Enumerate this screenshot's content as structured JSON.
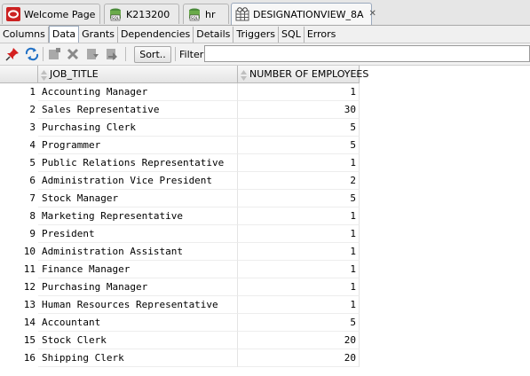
{
  "doc_tabs": [
    {
      "label": "Welcome Page",
      "icon": "oracle-icon"
    },
    {
      "label": "K213200",
      "icon": "sql-worksheet-icon"
    },
    {
      "label": "hr",
      "icon": "sql-worksheet-icon"
    },
    {
      "label": "DESIGNATIONVIEW_8A",
      "icon": "view-icon",
      "active": true
    }
  ],
  "sub_tabs": [
    "Columns",
    "Data",
    "Grants",
    "Dependencies",
    "Details",
    "Triggers",
    "SQL",
    "Errors"
  ],
  "active_sub_tab": "Data",
  "toolbar": {
    "icons": [
      "pin-icon",
      "refresh-icon",
      "insert-row-icon",
      "delete-row-icon",
      "commit-icon",
      "rollback-icon"
    ],
    "sort_label": "Sort..",
    "filter_label": "Filter:",
    "filter_value": ""
  },
  "grid": {
    "columns": [
      "JOB_TITLE",
      "NUMBER OF EMPLOYEES"
    ],
    "rows": [
      {
        "n": "1",
        "job": "Accounting Manager",
        "count": "1"
      },
      {
        "n": "2",
        "job": "Sales Representative",
        "count": "30"
      },
      {
        "n": "3",
        "job": "Purchasing Clerk",
        "count": "5"
      },
      {
        "n": "4",
        "job": "Programmer",
        "count": "5"
      },
      {
        "n": "5",
        "job": "Public Relations Representative",
        "count": "1"
      },
      {
        "n": "6",
        "job": "Administration Vice President",
        "count": "2"
      },
      {
        "n": "7",
        "job": "Stock Manager",
        "count": "5"
      },
      {
        "n": "8",
        "job": "Marketing Representative",
        "count": "1"
      },
      {
        "n": "9",
        "job": "President",
        "count": "1"
      },
      {
        "n": "10",
        "job": "Administration Assistant",
        "count": "1"
      },
      {
        "n": "11",
        "job": "Finance Manager",
        "count": "1"
      },
      {
        "n": "12",
        "job": "Purchasing Manager",
        "count": "1"
      },
      {
        "n": "13",
        "job": "Human Resources Representative",
        "count": "1"
      },
      {
        "n": "14",
        "job": "Accountant",
        "count": "5"
      },
      {
        "n": "15",
        "job": "Stock Clerk",
        "count": "20"
      },
      {
        "n": "16",
        "job": "Shipping Clerk",
        "count": "20"
      }
    ]
  },
  "colors": {
    "oracle_red": "#cc2222",
    "selection_blue": "#9aa9bd"
  }
}
